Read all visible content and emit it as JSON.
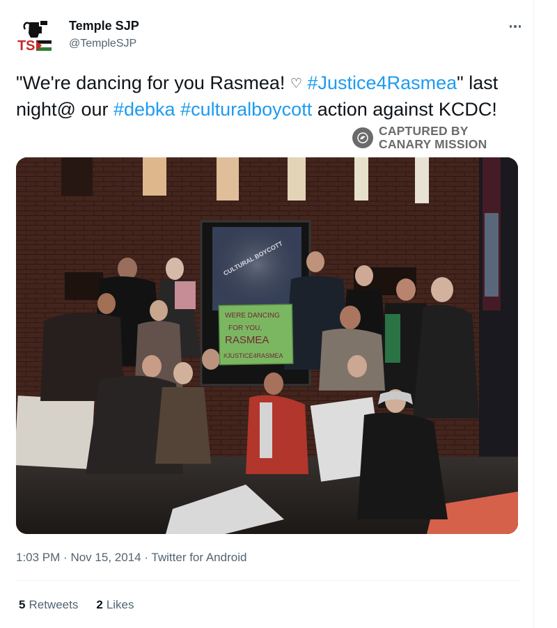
{
  "tweet": {
    "display_name": "Temple SJP",
    "handle": "@TempleSJP",
    "avatar_text": "TSJP",
    "text": {
      "part1": "\"We're dancing for you Rasmea! ",
      "heart": "♡",
      "space": " ",
      "tag1": "#Justice4Rasmea",
      "part2": "\" last night@ our ",
      "tag2": "#debka",
      "tag3": "#culturalboycott",
      "part3": " action against KCDC!"
    },
    "photo": {
      "sign_lines": [
        "WERE DANCING",
        "FOR YOU,",
        "RASMEA",
        "#JUSTICE4RASMEA"
      ],
      "poster_text": "CULTURAL BOYCOTT"
    },
    "time": "1:03 PM",
    "date": "Nov 15, 2014",
    "source": "Twitter for Android",
    "separator": "·",
    "retweets_count": "5",
    "retweets_label": "Retweets",
    "likes_count": "2",
    "likes_label": "Likes"
  },
  "watermark": {
    "line1": "CAPTURED BY",
    "line2": "CANARY MISSION"
  },
  "colors": {
    "link": "#1d9bf0",
    "text": "#0f1419",
    "secondary": "#536471",
    "watermark": "#6b6b6b"
  },
  "icons": [
    "more-options-icon",
    "canary-mission-icon",
    "sjp-logo"
  ]
}
